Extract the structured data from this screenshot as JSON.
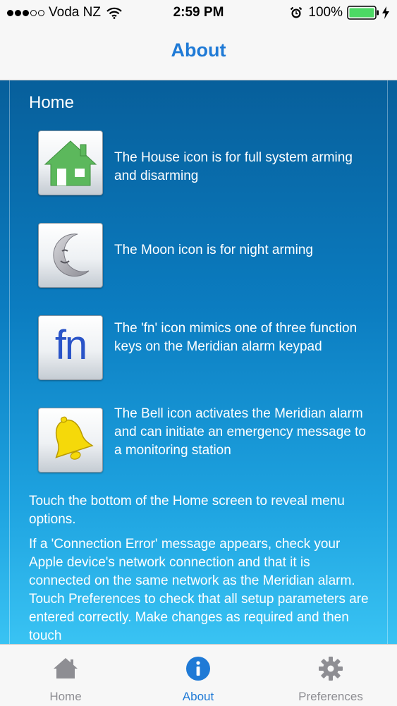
{
  "status_bar": {
    "signal_filled": 3,
    "signal_total": 5,
    "carrier": "Voda NZ",
    "time": "2:59 PM",
    "battery_percent": "100%",
    "icons": [
      "wifi-icon",
      "alarm-clock-icon",
      "battery-icon",
      "charging-bolt-icon"
    ]
  },
  "nav": {
    "title": "About"
  },
  "content": {
    "section_title": "Home",
    "features": [
      {
        "icon": "house-icon",
        "text": "The House icon is for full system arming and disarming"
      },
      {
        "icon": "moon-icon",
        "text": "The Moon icon is for night arming"
      },
      {
        "icon": "fn-icon",
        "icon_text": "fn",
        "text": "The 'fn' icon mimics one of three function keys on the Meridian alarm keypad"
      },
      {
        "icon": "bell-icon",
        "text": "The Bell icon activates the Meridian alarm and can initiate an emergency message to a monitoring station"
      }
    ],
    "paragraphs": [
      "Touch the bottom of the Home screen to reveal menu options.",
      "If a 'Connection Error' message appears, check your Apple device's network connection and that it is connected on the same network as the Meridian alarm. Touch Preferences to check that all setup parameters are entered correctly. Make changes as required and then touch"
    ]
  },
  "tab_bar": {
    "tabs": [
      {
        "label": "Home",
        "icon": "house-icon",
        "active": false
      },
      {
        "label": "About",
        "icon": "info-icon",
        "active": true
      },
      {
        "label": "Preferences",
        "icon": "gear-icon",
        "active": false
      }
    ]
  },
  "colors": {
    "accent": "#1f7ad6",
    "inactive_tab": "#8e8e93",
    "content_gradient_top": "#075f9b",
    "content_gradient_bottom": "#39c3f3",
    "house_green": "#5cb85c",
    "bell_yellow": "#f5d90a",
    "fn_blue": "#2a54c8"
  }
}
